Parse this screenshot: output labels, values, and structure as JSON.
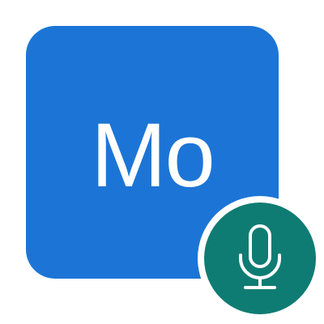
{
  "app_icon": {
    "initials": "Mo",
    "tile_color": "#1c75d6",
    "text_color": "#ffffff"
  },
  "badge": {
    "icon": "microphone-icon",
    "background_color": "#0f7c73",
    "ring_color": "#ffffff",
    "icon_color": "#ffffff"
  }
}
